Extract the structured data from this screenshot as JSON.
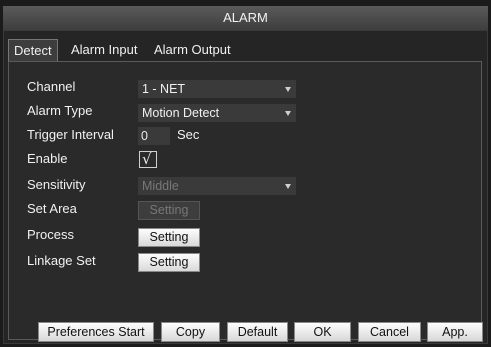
{
  "window": {
    "title": "ALARM"
  },
  "tabs": [
    {
      "label": "Detect",
      "active": true
    },
    {
      "label": "Alarm Input",
      "active": false
    },
    {
      "label": "Alarm Output",
      "active": false
    }
  ],
  "form": {
    "channel": {
      "label": "Channel",
      "value": "1 - NET"
    },
    "alarm_type": {
      "label": "Alarm Type",
      "value": "Motion Detect"
    },
    "trigger_interval": {
      "label": "Trigger Interval",
      "value": "0",
      "unit": "Sec"
    },
    "enable": {
      "label": "Enable",
      "checked": true,
      "glyph": "√"
    },
    "sensitivity": {
      "label": "Sensitivity",
      "value": "Middle",
      "disabled": true
    },
    "set_area": {
      "label": "Set Area",
      "button": "Setting",
      "disabled": true
    },
    "process": {
      "label": "Process",
      "button": "Setting"
    },
    "linkage_set": {
      "label": "Linkage Set",
      "button": "Setting"
    }
  },
  "footer": {
    "preferences": "Preferences Start",
    "copy": "Copy",
    "default": "Default",
    "ok": "OK",
    "cancel": "Cancel",
    "apply": "App."
  }
}
